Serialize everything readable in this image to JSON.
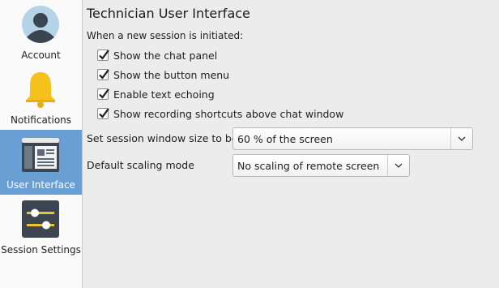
{
  "sidebar": {
    "items": [
      {
        "label": "Account",
        "icon": "account-icon",
        "selected": false
      },
      {
        "label": "Notifications",
        "icon": "bell-icon",
        "selected": false
      },
      {
        "label": "User Interface",
        "icon": "user-interface-icon",
        "selected": true
      },
      {
        "label": "Session Settings",
        "icon": "sliders-icon",
        "selected": false
      }
    ],
    "selected_color": "#6a9fd3"
  },
  "main": {
    "title": "Technician User Interface",
    "session_intro": "When a new session is initiated:",
    "checkboxes": [
      {
        "label": "Show the chat panel",
        "checked": true
      },
      {
        "label": "Show the button menu",
        "checked": true
      },
      {
        "label": "Enable text echoing",
        "checked": true
      },
      {
        "label": "Show recording shortcuts above chat window",
        "checked": true
      }
    ],
    "window_size": {
      "label": "Set session window size to be",
      "value": "60 % of the screen"
    },
    "scaling_mode": {
      "label": "Default scaling mode",
      "value": "No scaling of remote screen"
    }
  }
}
